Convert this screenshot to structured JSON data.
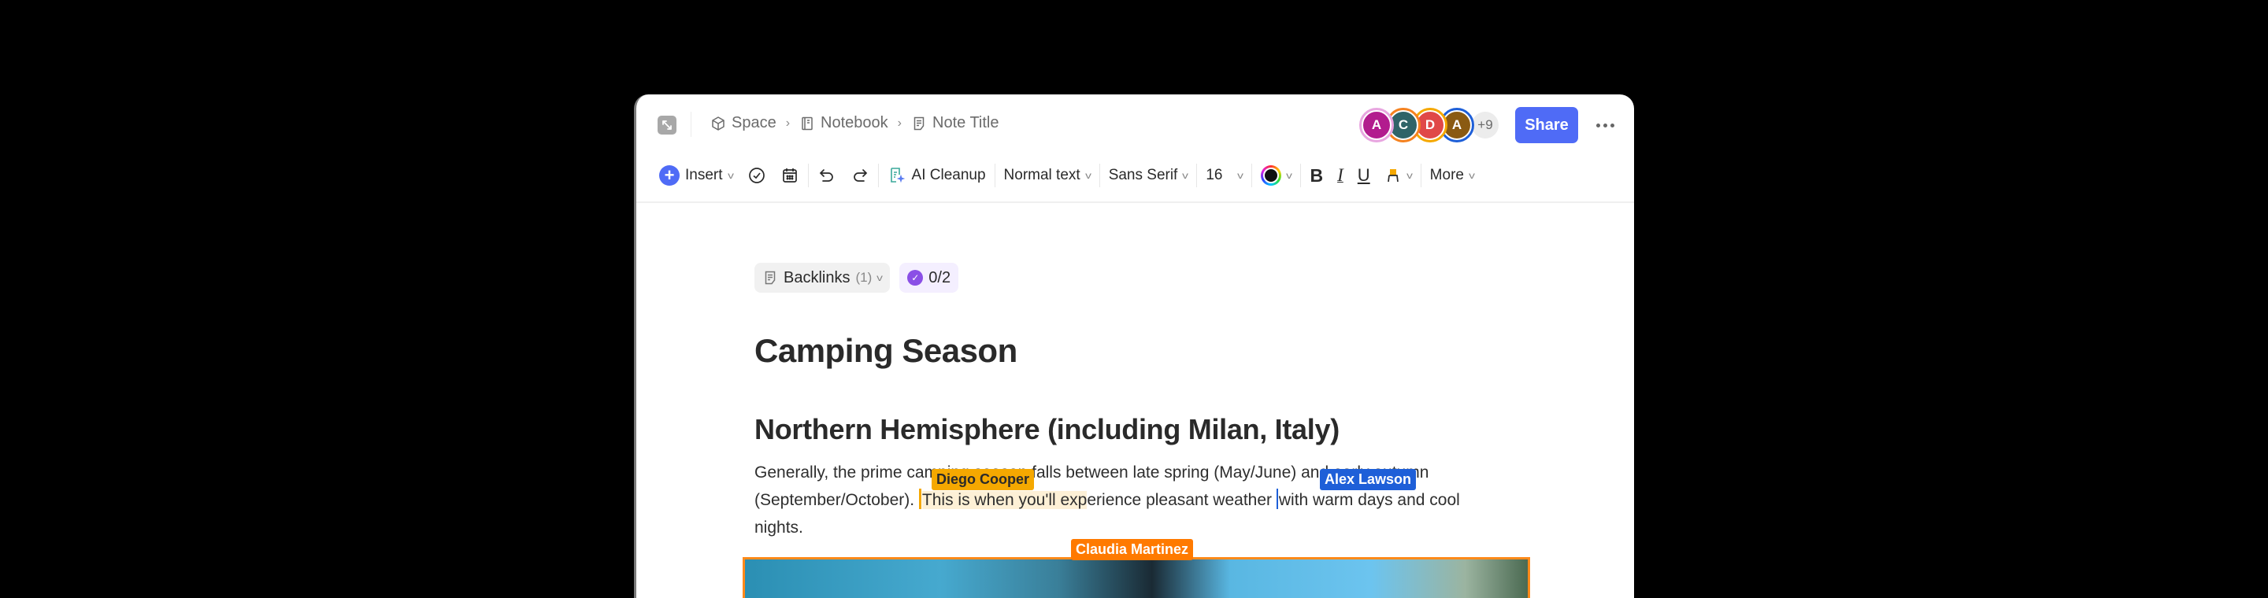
{
  "breadcrumb": [
    {
      "label": "Space",
      "icon": "cube-icon"
    },
    {
      "label": "Notebook",
      "icon": "notebook-icon"
    },
    {
      "label": "Note Title",
      "icon": "note-icon"
    }
  ],
  "collaborators": [
    {
      "initial": "A",
      "color": "#b21c8e",
      "ring": "#e8a6e0"
    },
    {
      "initial": "C",
      "color": "#2f6468",
      "ring": "#f58220"
    },
    {
      "initial": "D",
      "color": "#e04848",
      "ring": "#f5a800"
    },
    {
      "initial": "A",
      "color": "#8a5a12",
      "ring": "#1e5fd8"
    }
  ],
  "collaborators_more": "+9",
  "share_label": "Share",
  "toolbar": {
    "insert_label": "Insert",
    "ai_cleanup_label": "AI Cleanup",
    "text_style": "Normal text",
    "font_family": "Sans Serif",
    "font_size": "16",
    "more_label": "More",
    "accent": "#4f6bf6"
  },
  "meta": {
    "backlinks_label": "Backlinks",
    "backlinks_count": "(1)",
    "tasks_progress": "0/2"
  },
  "document": {
    "title": "Camping Season",
    "heading": "Northern Hemisphere (including Milan, Italy)",
    "para_part1": "Generally, the prime camping season falls between late spring (May/June) and early autumn (September/October). ",
    "para_highlight": "This is when you'll exp",
    "para_part2": "erience pleasant weather ",
    "para_part3": "with warm days and cool nights."
  },
  "cursors": {
    "diego": "Diego Cooper",
    "alex": "Alex Lawson",
    "claudia": "Claudia Martinez"
  }
}
